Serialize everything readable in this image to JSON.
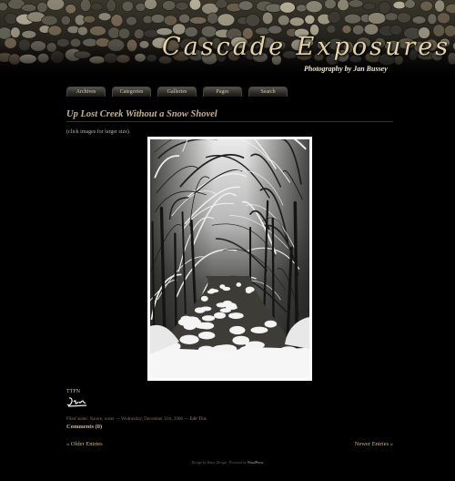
{
  "header": {
    "title": "Cascade Exposures",
    "tagline": "Photography by Jan Bussey"
  },
  "nav": {
    "tabs": [
      {
        "label": "Archives"
      },
      {
        "label": "Categories"
      },
      {
        "label": "Galleries"
      },
      {
        "label": "Pages"
      },
      {
        "label": "Search"
      }
    ]
  },
  "post": {
    "title": "Up Lost Creek Without a Snow Shovel",
    "note": "(click images for larger size)",
    "signoff": "TTFN",
    "signature": "Jan",
    "meta": {
      "filed_prefix": "Filed under: Nature, water — Wednesday, December 31st, 2008 —",
      "edit": "Edit This"
    },
    "comments": "Comments (0)"
  },
  "pagination": {
    "older": "« Older Entries",
    "newer": "Newer Entries »"
  },
  "footer": {
    "prefix": "Design by",
    "designer": "Ibnec Design",
    "middle": "· Powered by",
    "platform": "WordPress"
  }
}
